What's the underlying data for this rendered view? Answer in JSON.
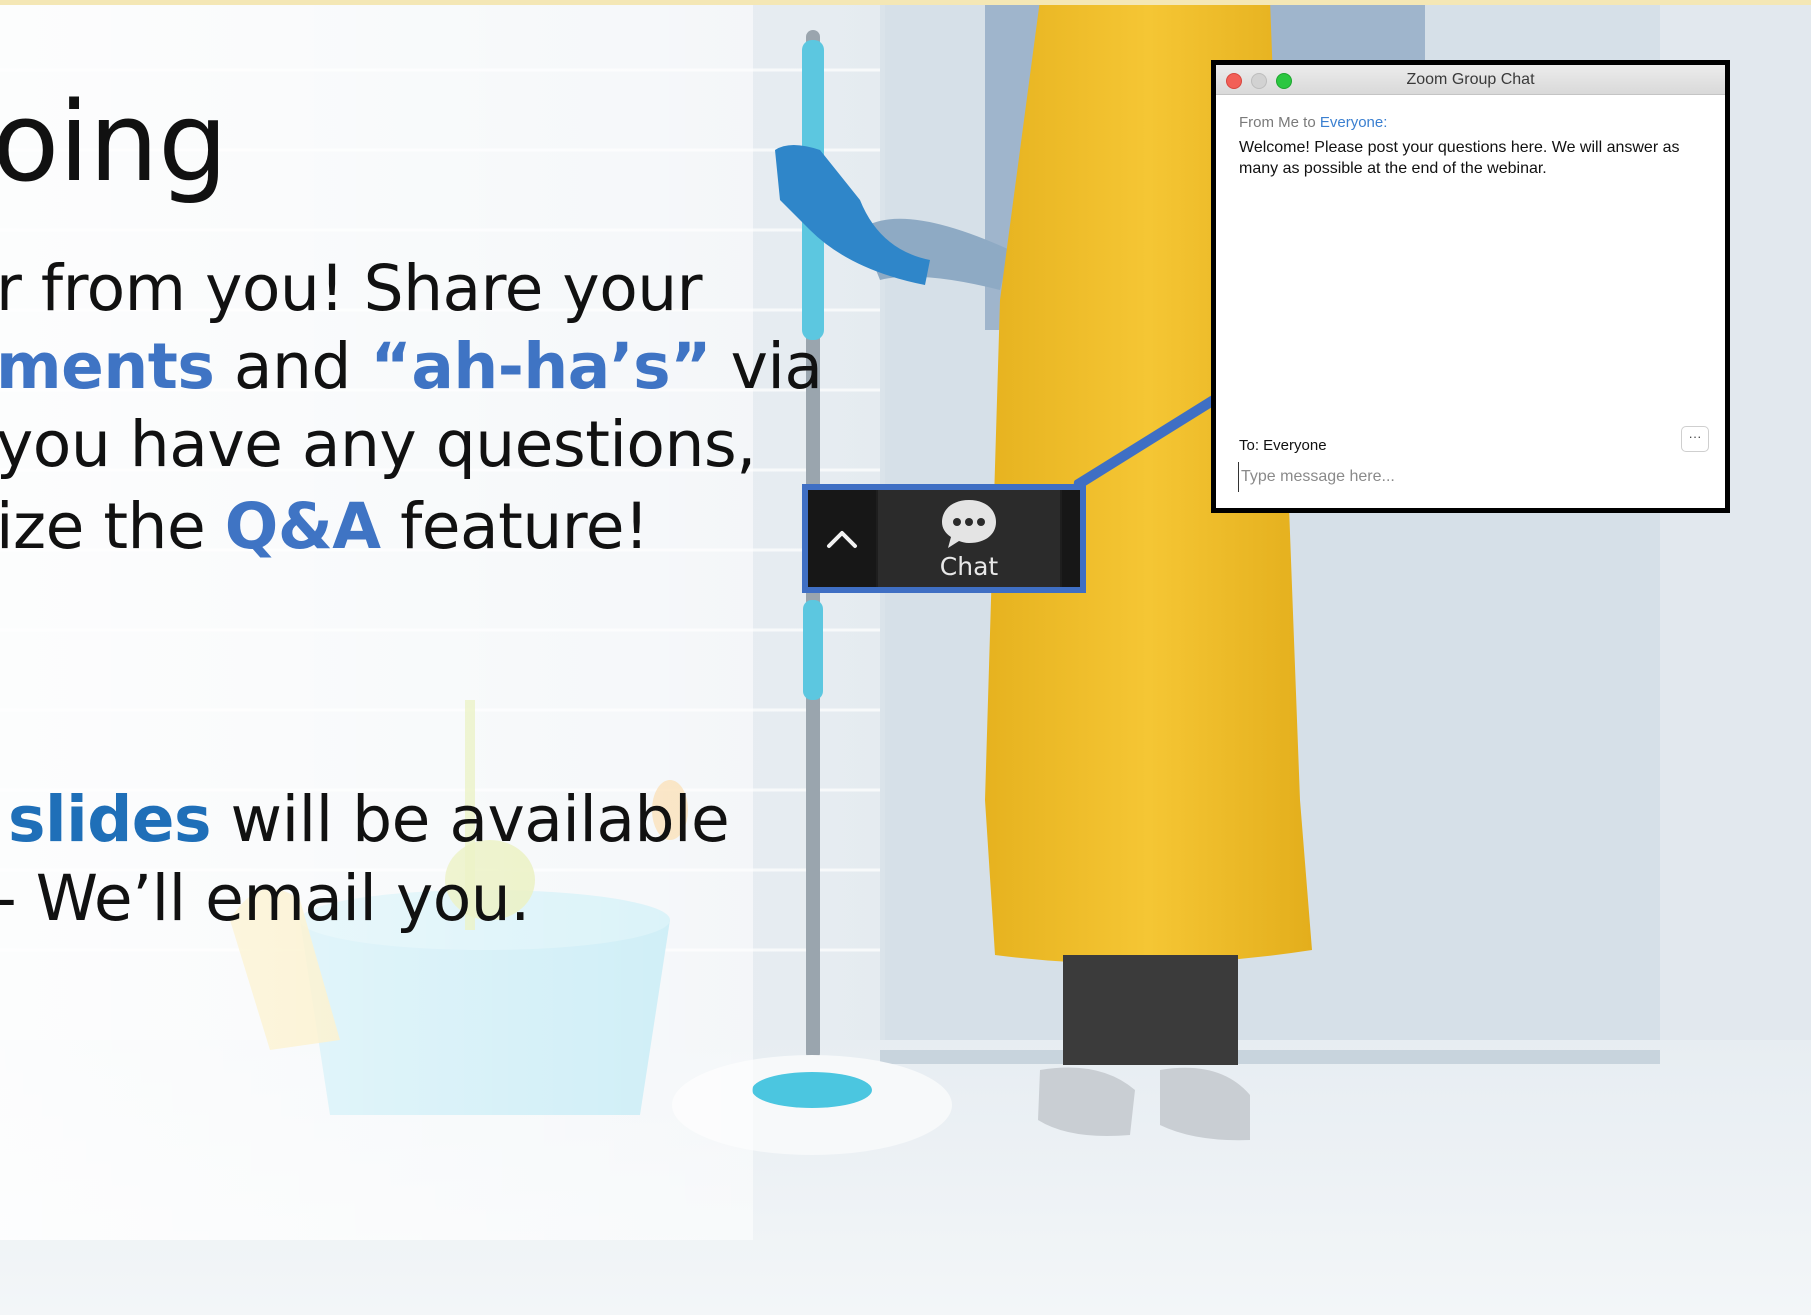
{
  "slide": {
    "title_fragment": "oing",
    "para1": {
      "l1": "r from you! Share your",
      "l2a": "ments",
      "l2b": " and ",
      "l2c": "“ah-ha’s”",
      "l2d": " via",
      "l3": "you have any questions,",
      "l4a": "ize the ",
      "l4b": "Q&A",
      "l4c": " feature!"
    },
    "para2": {
      "l1a": "slides",
      "l1b": " will be available",
      "l2": "- We’ll email you."
    }
  },
  "toolbar": {
    "chat_label": "Chat",
    "expand_icon": "chevron-up-icon",
    "chat_icon": "speech-bubble-icon"
  },
  "chat_window": {
    "title": "Zoom Group Chat",
    "message": {
      "from_prefix": "From Me to ",
      "to": "Everyone:",
      "body": "Welcome!  Please post your questions here. We will answer as many as possible at the end of the webinar."
    },
    "recipient": "To: Everyone",
    "more_label": "···",
    "input_placeholder": "Type message here..."
  },
  "colors": {
    "highlight": "#3f74c4",
    "toolbar_border": "#3f6fc4",
    "arrow": "#3f6fc4",
    "apron": "#f2c12e"
  }
}
